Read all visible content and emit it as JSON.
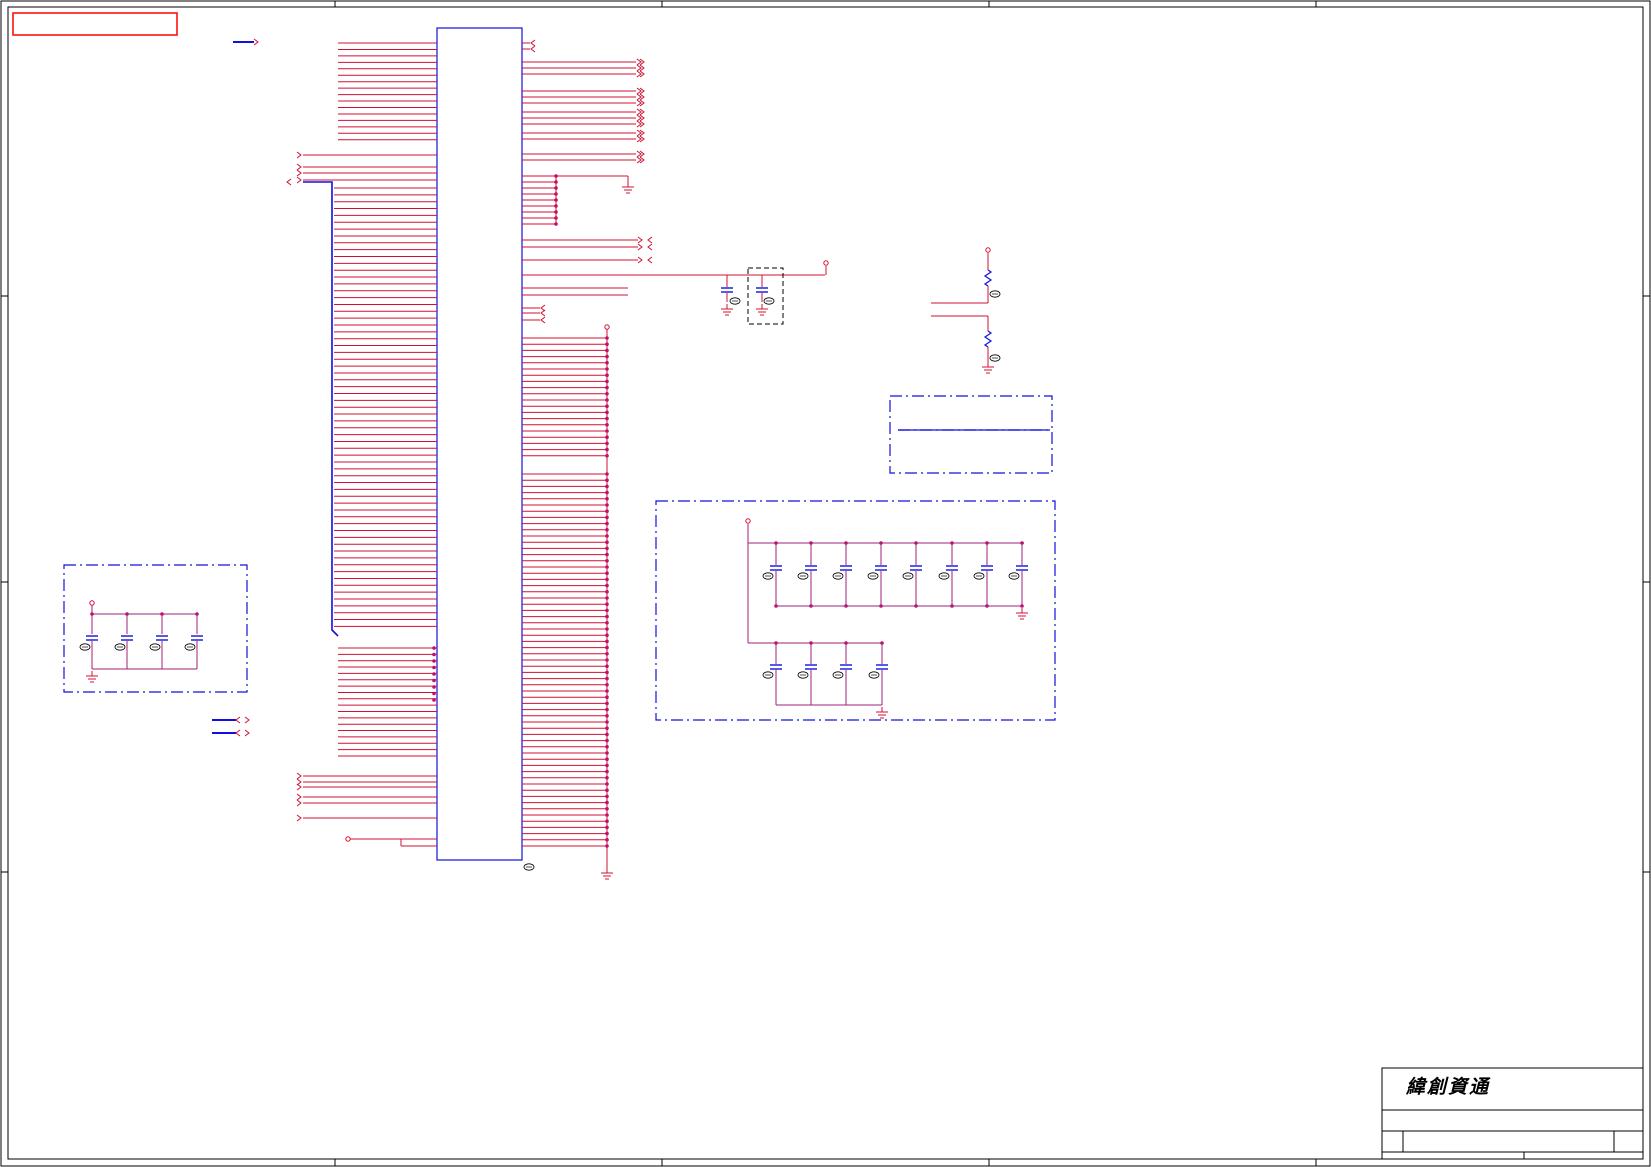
{
  "title_block": {
    "company_logo": "緯創資通"
  },
  "colors": {
    "wire": "#d01030",
    "bus": "#1010e0",
    "part": "#1010e0",
    "junction": "#c0106f",
    "frame": "#000000",
    "net_flag": "#ff0000",
    "dash_box": "#1010e0",
    "cap_link": "#a0207a"
  },
  "icons": {
    "ground": "ground-symbol-icon",
    "capacitor": "capacitor-icon",
    "resistor": "resistor-icon",
    "offpage": "offpage-connector-icon",
    "not_stuff": "not-stuffed-marker-icon"
  }
}
